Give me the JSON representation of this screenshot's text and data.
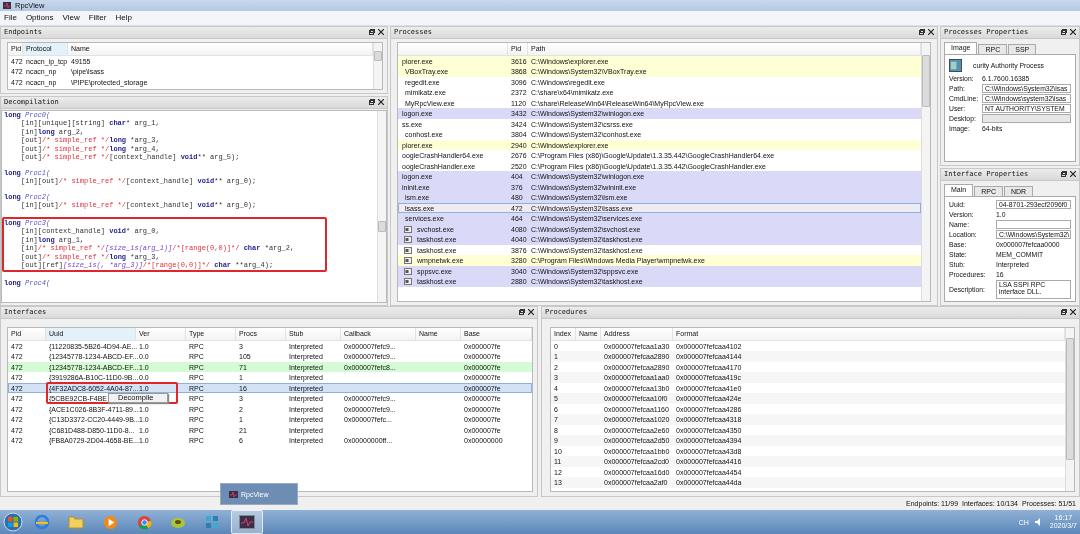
{
  "window": {
    "title": "RpcView"
  },
  "menu": [
    {
      "label": "File"
    },
    {
      "label": "Options"
    },
    {
      "label": "View"
    },
    {
      "label": "Filter"
    },
    {
      "label": "Help"
    }
  ],
  "endpoints": {
    "title": "Endpoints",
    "columns": [
      "Pid",
      "Protocol",
      "Name"
    ],
    "rows": [
      [
        "472",
        "ncacn_ip_tcp",
        "49155"
      ],
      [
        "472",
        "ncacn_np",
        "\\pipe\\lsass"
      ],
      [
        "472",
        "ncacn_np",
        "\\PIPE\\protected_storage"
      ]
    ]
  },
  "decompilation": {
    "title": "Decompilation",
    "blocks": [
      {
        "annotated": false,
        "lines": [
          [
            {
              "kind": "kw",
              "text": "long "
            },
            {
              "kind": "fn",
              "text": "Proc0("
            }
          ],
          [
            {
              "kind": "tx",
              "text": "[in][unique][string] "
            },
            {
              "kind": "kw",
              "text": "char"
            },
            {
              "kind": "tx",
              "text": "* arg_1,"
            }
          ],
          [
            {
              "kind": "tx",
              "text": "[in]"
            },
            {
              "kind": "kw",
              "text": "long"
            },
            {
              "kind": "tx",
              "text": " arg_2,"
            }
          ],
          [
            {
              "kind": "tx",
              "text": "[out]"
            },
            {
              "kind": "cm",
              "text": "/* simple_ref */"
            },
            {
              "kind": "kw",
              "text": "long"
            },
            {
              "kind": "tx",
              "text": " *arg_3,"
            }
          ],
          [
            {
              "kind": "tx",
              "text": "[out]"
            },
            {
              "kind": "cm",
              "text": "/* simple_ref */"
            },
            {
              "kind": "kw",
              "text": "long"
            },
            {
              "kind": "tx",
              "text": " *arg_4,"
            }
          ],
          [
            {
              "kind": "tx",
              "text": "[out]"
            },
            {
              "kind": "cm",
              "text": "/* simple_ref */"
            },
            {
              "kind": "tx",
              "text": "[context_handle] "
            },
            {
              "kind": "kw",
              "text": "void"
            },
            {
              "kind": "tx",
              "text": "** arg_5);"
            }
          ]
        ]
      },
      {
        "annotated": false,
        "lines": [
          [
            {
              "kind": "kw",
              "text": "long "
            },
            {
              "kind": "fn",
              "text": "Proc1("
            }
          ],
          [
            {
              "kind": "tx",
              "text": "[in][out]"
            },
            {
              "kind": "cm",
              "text": "/* simple_ref */"
            },
            {
              "kind": "tx",
              "text": "[context_handle] "
            },
            {
              "kind": "kw",
              "text": "void"
            },
            {
              "kind": "tx",
              "text": "** arg_0);"
            }
          ]
        ]
      },
      {
        "annotated": false,
        "lines": [
          [
            {
              "kind": "kw",
              "text": "long "
            },
            {
              "kind": "fn",
              "text": "Proc2("
            }
          ],
          [
            {
              "kind": "tx",
              "text": "[in][out]"
            },
            {
              "kind": "cm",
              "text": "/* simple_ref */"
            },
            {
              "kind": "tx",
              "text": "[context_handle] "
            },
            {
              "kind": "kw",
              "text": "void"
            },
            {
              "kind": "tx",
              "text": "** arg_0);"
            }
          ]
        ]
      },
      {
        "annotated": true,
        "lines": [
          [
            {
              "kind": "kw",
              "text": "long "
            },
            {
              "kind": "fn",
              "text": "Proc3("
            }
          ],
          [
            {
              "kind": "tx",
              "text": "[in][context_handle] "
            },
            {
              "kind": "kw",
              "text": "void"
            },
            {
              "kind": "tx",
              "text": "* arg_0,"
            }
          ],
          [
            {
              "kind": "tx",
              "text": "[in]"
            },
            {
              "kind": "kw",
              "text": "long"
            },
            {
              "kind": "tx",
              "text": " arg_1,"
            }
          ],
          [
            {
              "kind": "tx",
              "text": "[in]"
            },
            {
              "kind": "cm",
              "text": "/* simple_ref */"
            },
            {
              "kind": "at",
              "text": "[size_is(arg_1)]"
            },
            {
              "kind": "cm",
              "text": "/*[range(0,0)]*/"
            },
            {
              "kind": "kw",
              "text": " char"
            },
            {
              "kind": "tx",
              "text": " *arg_2,"
            }
          ],
          [
            {
              "kind": "tx",
              "text": "[out]"
            },
            {
              "kind": "cm",
              "text": "/* simple_ref */"
            },
            {
              "kind": "kw",
              "text": "long"
            },
            {
              "kind": "tx",
              "text": " *arg_3,"
            }
          ],
          [
            {
              "kind": "tx",
              "text": "[out][ref]"
            },
            {
              "kind": "at",
              "text": "[size_is(, *arg_3)]"
            },
            {
              "kind": "cm",
              "text": "/*[range(0,0)]*/"
            },
            {
              "kind": "kw",
              "text": " char"
            },
            {
              "kind": "tx",
              "text": " **arg_4);"
            }
          ]
        ]
      },
      {
        "annotated": false,
        "lines": [
          [
            {
              "kind": "kw",
              "text": "long "
            },
            {
              "kind": "fn",
              "text": "Proc4("
            }
          ]
        ]
      }
    ]
  },
  "processes": {
    "title": "Processes",
    "columns": [
      "Pid",
      "Path"
    ],
    "rows": [
      {
        "name": "plorer.exe",
        "pid": "3616",
        "path": "C:\\Windows\\explorer.exe",
        "color": "#ffffd6",
        "selected": false,
        "children": [
          {
            "name": "VBoxTray.exe",
            "pid": "3868",
            "path": "C:\\Windows\\System32\\VBoxTray.exe",
            "color": "#ffffd6",
            "selected": false
          },
          {
            "name": "regedit.exe",
            "pid": "3096",
            "path": "C:\\Windows\\regedit.exe",
            "color": "#ffffff",
            "selected": false
          },
          {
            "name": "mimikatz.exe",
            "pid": "2372",
            "path": "C:\\share\\x64\\mimikatz.exe",
            "color": "#ffffff",
            "selected": false
          },
          {
            "name": "MyRpcView.exe",
            "pid": "1120",
            "path": "C:\\share\\ReleaseWin64\\ReleaseWin64\\MyRpcView.exe",
            "color": "#ffffff",
            "selected": false
          }
        ]
      },
      {
        "name": "logon.exe",
        "pid": "3432",
        "path": "C:\\Windows\\System32\\winlogon.exe",
        "color": "#dadaf8",
        "selected": false
      },
      {
        "name": "ss.exe",
        "pid": "3424",
        "path": "C:\\Windows\\System32\\csrss.exe",
        "color": "#ffffff",
        "selected": false,
        "children": [
          {
            "name": "conhost.exe",
            "pid": "3804",
            "path": "C:\\Windows\\System32\\conhost.exe",
            "color": "#ffffff",
            "selected": false
          }
        ]
      },
      {
        "name": "plorer.exe",
        "pid": "2940",
        "path": "C:\\Windows\\explorer.exe",
        "color": "#ffffd6",
        "selected": false
      },
      {
        "name": "oogleCrashHandler64.exe",
        "pid": "2676",
        "path": "C:\\Program Files (x86)\\Google\\Update\\1.3.35.442\\GoogleCrashHandler64.exe",
        "color": "#ffffff",
        "selected": false
      },
      {
        "name": "oogleCrashHandler.exe",
        "pid": "2520",
        "path": "C:\\Program Files (x86)\\Google\\Update\\1.3.35.442\\GoogleCrashHandler.exe",
        "color": "#ffffff",
        "selected": false
      },
      {
        "name": "logon.exe",
        "pid": "404",
        "path": "C:\\Windows\\System32\\winlogon.exe",
        "color": "#dadaf8",
        "selected": false
      },
      {
        "name": "ininit.exe",
        "pid": "376",
        "path": "C:\\Windows\\System32\\wininit.exe",
        "color": "#dadaf8",
        "selected": false,
        "children": [
          {
            "name": "lsm.exe",
            "pid": "480",
            "path": "C:\\Windows\\System32\\lsm.exe",
            "color": "#dadaf8",
            "selected": false
          },
          {
            "name": "lsass.exe",
            "pid": "472",
            "path": "C:\\Windows\\System32\\lsass.exe",
            "color": "#ececf2",
            "selected": true
          },
          {
            "name": "services.exe",
            "pid": "464",
            "path": "C:\\Windows\\System32\\services.exe",
            "color": "#dadaf8",
            "selected": false,
            "children": [
              {
                "name": "svchost.exe",
                "pid": "4080",
                "path": "C:\\Windows\\System32\\svchost.exe",
                "color": "#dadaf8",
                "selected": false
              },
              {
                "name": "taskhost.exe",
                "pid": "4040",
                "path": "C:\\Windows\\System32\\taskhost.exe",
                "color": "#dadaf8",
                "selected": false
              },
              {
                "name": "taskhost.exe",
                "pid": "3876",
                "path": "C:\\Windows\\System32\\taskhost.exe",
                "color": "#ffffff",
                "selected": false
              },
              {
                "name": "wmpnetwk.exe",
                "pid": "3280",
                "path": "C:\\Program Files\\Windows Media Player\\wmpnetwk.exe",
                "color": "#ffffd6",
                "selected": false
              },
              {
                "name": "sppsvc.exe",
                "pid": "3040",
                "path": "C:\\Windows\\System32\\sppsvc.exe",
                "color": "#dadaf8",
                "selected": false
              },
              {
                "name": "taskhost.exe",
                "pid": "2880",
                "path": "C:\\Windows\\System32\\taskhost.exe",
                "color": "#dadaf8",
                "selected": false
              }
            ]
          }
        ]
      }
    ]
  },
  "process_properties": {
    "title": "Processes Properties",
    "tabs": [
      {
        "label": "Image",
        "selected": true
      },
      {
        "label": "RPC",
        "selected": false
      },
      {
        "label": "SSP",
        "selected": false
      }
    ],
    "description": "curity Authority Process",
    "fields": [
      {
        "kind": "text",
        "label": "Version:",
        "value": "6.1.7600.16385"
      },
      {
        "kind": "field",
        "label": "Path:",
        "value": "C:\\Windows\\System32\\lsas"
      },
      {
        "kind": "field",
        "label": "CmdLine:",
        "value": "C:\\Windows\\system32\\lsas"
      },
      {
        "kind": "field",
        "label": "User:",
        "value": "NT AUTHORITY\\SYSTEM"
      },
      {
        "kind": "field",
        "label": "Desktop:",
        "disabled": true
      },
      {
        "kind": "text",
        "label": "Image:",
        "value": "64-bits"
      }
    ]
  },
  "interface_properties": {
    "title": "Interface Properties",
    "tabs": [
      {
        "label": "Main",
        "selected": true
      },
      {
        "label": "RPC",
        "selected": false
      },
      {
        "label": "NDR",
        "selected": false
      }
    ],
    "fields": [
      {
        "kind": "field",
        "label": "Uuid:",
        "value": "04-8701-293ecf2096f0"
      },
      {
        "kind": "text",
        "label": "Version:",
        "value": "1.0"
      },
      {
        "kind": "field",
        "label": "Name:"
      },
      {
        "kind": "field",
        "label": "Location:",
        "value": "C:\\Windows\\System32\\"
      },
      {
        "kind": "text",
        "label": "Base:",
        "value": "0x000007fefcaa0000"
      },
      {
        "kind": "text",
        "label": "State:",
        "value": "MEM_COMMIT"
      },
      {
        "kind": "text",
        "label": "Stub:",
        "value": "Interpreted"
      },
      {
        "kind": "text",
        "label": "Procedures:",
        "value": "16"
      },
      {
        "kind": "area",
        "label": "Description:",
        "value": "LSA SSPI RPC interface DLL."
      }
    ]
  },
  "interfaces": {
    "title": "Interfaces",
    "columns": [
      "Pid",
      "Uuid",
      "Ver",
      "Type",
      "Procs",
      "Stub",
      "Callback",
      "Name",
      "Base"
    ],
    "rows": [
      {
        "pid": "472",
        "uuid": "{11220835-5B26-4D94-AE...",
        "ver": "1.0",
        "type": "RPC",
        "procs": "3",
        "stub": "Interpreted",
        "callback": "0x000007fefc9...",
        "base": "0x000007fe",
        "color": "#ffffff",
        "selected": false
      },
      {
        "pid": "472",
        "uuid": "{12345778-1234-ABCD-EF...",
        "ver": "0.0",
        "type": "RPC",
        "procs": "105",
        "stub": "Interpreted",
        "callback": "0x000007fefc9...",
        "base": "0x000007fe",
        "color": "#ffffff",
        "selected": false
      },
      {
        "pid": "472",
        "uuid": "{12345778-1234-ABCD-EF...",
        "ver": "1.0",
        "type": "RPC",
        "procs": "71",
        "stub": "Interpreted",
        "callback": "0x000007fefc8...",
        "base": "0x000007fe",
        "color": "#d4fbd4",
        "selected": false
      },
      {
        "pid": "472",
        "uuid": "{3919286A-B10C-11D0-9B...",
        "ver": "0.0",
        "type": "RPC",
        "procs": "1",
        "stub": "Interpreted",
        "base": "0x000007fe",
        "color": "#ffffff",
        "selected": false
      },
      {
        "pid": "472",
        "uuid": "{4F32ADC8-6052-4A04-87...",
        "ver": "1.0",
        "type": "RPC",
        "procs": "16",
        "stub": "Interpreted",
        "base": "0x000007fe",
        "color": "#d3e2f4",
        "selected": true
      },
      {
        "pid": "472",
        "uuid": "{5CBE92CB-F4BE",
        "type": "RPC",
        "procs": "3",
        "stub": "Interpreted",
        "callback": "0x000007fefc9...",
        "base": "0x000007fe",
        "color": "#ffffff",
        "selected": false
      },
      {
        "pid": "472",
        "uuid": "{ACE1C026-8B3F-4711-89...",
        "ver": "1.0",
        "type": "RPC",
        "procs": "2",
        "stub": "Interpreted",
        "callback": "0x000007fefc9...",
        "base": "0x000007fe",
        "color": "#ffffff",
        "selected": false
      },
      {
        "pid": "472",
        "uuid": "{C13D3372-CC20-4449-9B...",
        "ver": "1.0",
        "type": "RPC",
        "procs": "1",
        "stub": "Interpreted",
        "callback": "0x000007fefc...",
        "base": "0x000007fe",
        "color": "#ffffff",
        "selected": false
      },
      {
        "pid": "472",
        "uuid": "{C681D488-D850-11D0-8...",
        "ver": "1.0",
        "type": "RPC",
        "procs": "21",
        "stub": "Interpreted",
        "base": "0x000007fe",
        "color": "#ffffff",
        "selected": false
      },
      {
        "pid": "472",
        "uuid": "{FB8A0729-2D04-4658-BE...",
        "ver": "1.0",
        "type": "RPC",
        "procs": "6",
        "stub": "Interpreted",
        "callback": "0x00000000ff...",
        "base": "0x00000000",
        "color": "#ffffff",
        "selected": false
      }
    ],
    "context_menu": {
      "items": [
        {
          "label": "Decompile"
        }
      ]
    }
  },
  "procedures": {
    "title": "Procedures",
    "columns": [
      "Index",
      "Name",
      "Address",
      "Format"
    ],
    "rows": [
      [
        "0",
        "",
        "0x000007fefcaa1a30",
        "0x000007fefcaa4102"
      ],
      [
        "1",
        "",
        "0x000007fefcaa2890",
        "0x000007fefcaa4144"
      ],
      [
        "2",
        "",
        "0x000007fefcaa2890",
        "0x000007fefcaa4170"
      ],
      [
        "3",
        "",
        "0x000007fefcaa1aa0",
        "0x000007fefcaa419c"
      ],
      [
        "4",
        "",
        "0x000007fefcaa13b0",
        "0x000007fefcaa41e0"
      ],
      [
        "5",
        "",
        "0x000007fefcaa10f0",
        "0x000007fefcaa424e"
      ],
      [
        "6",
        "",
        "0x000007fefcaa1160",
        "0x000007fefcaa4286"
      ],
      [
        "7",
        "",
        "0x000007fefcaa1020",
        "0x000007fefcaa4318"
      ],
      [
        "8",
        "",
        "0x000007fefcaa2e60",
        "0x000007fefcaa4350"
      ],
      [
        "9",
        "",
        "0x000007fefcaa2d50",
        "0x000007fefcaa4394"
      ],
      [
        "10",
        "",
        "0x000007fefcaa1bb0",
        "0x000007fefcaa43d8"
      ],
      [
        "11",
        "",
        "0x000007fefcaa2cd0",
        "0x000007fefcaa4416"
      ],
      [
        "12",
        "",
        "0x000007fefcaa16d0",
        "0x000007fefcaa4454"
      ],
      [
        "13",
        "",
        "0x000007fefcaa2af0",
        "0x000007fefcaa44da"
      ]
    ]
  },
  "status_bar": {
    "text": "Endpoints: 11/99  Interfaces: 10/134  Processes: 51/51"
  },
  "taskbar": {
    "preview": "RpcView",
    "language": "CH",
    "time": "16:17",
    "date": "2020/3/7",
    "apps": [
      {
        "kind": "ie",
        "active": false
      },
      {
        "kind": "folder",
        "active": false
      },
      {
        "kind": "media",
        "active": false
      },
      {
        "kind": "chrome",
        "active": false
      },
      {
        "kind": "kiwi",
        "active": false
      },
      {
        "kind": "dots",
        "active": false
      },
      {
        "kind": "rpcview",
        "active": true
      }
    ]
  }
}
